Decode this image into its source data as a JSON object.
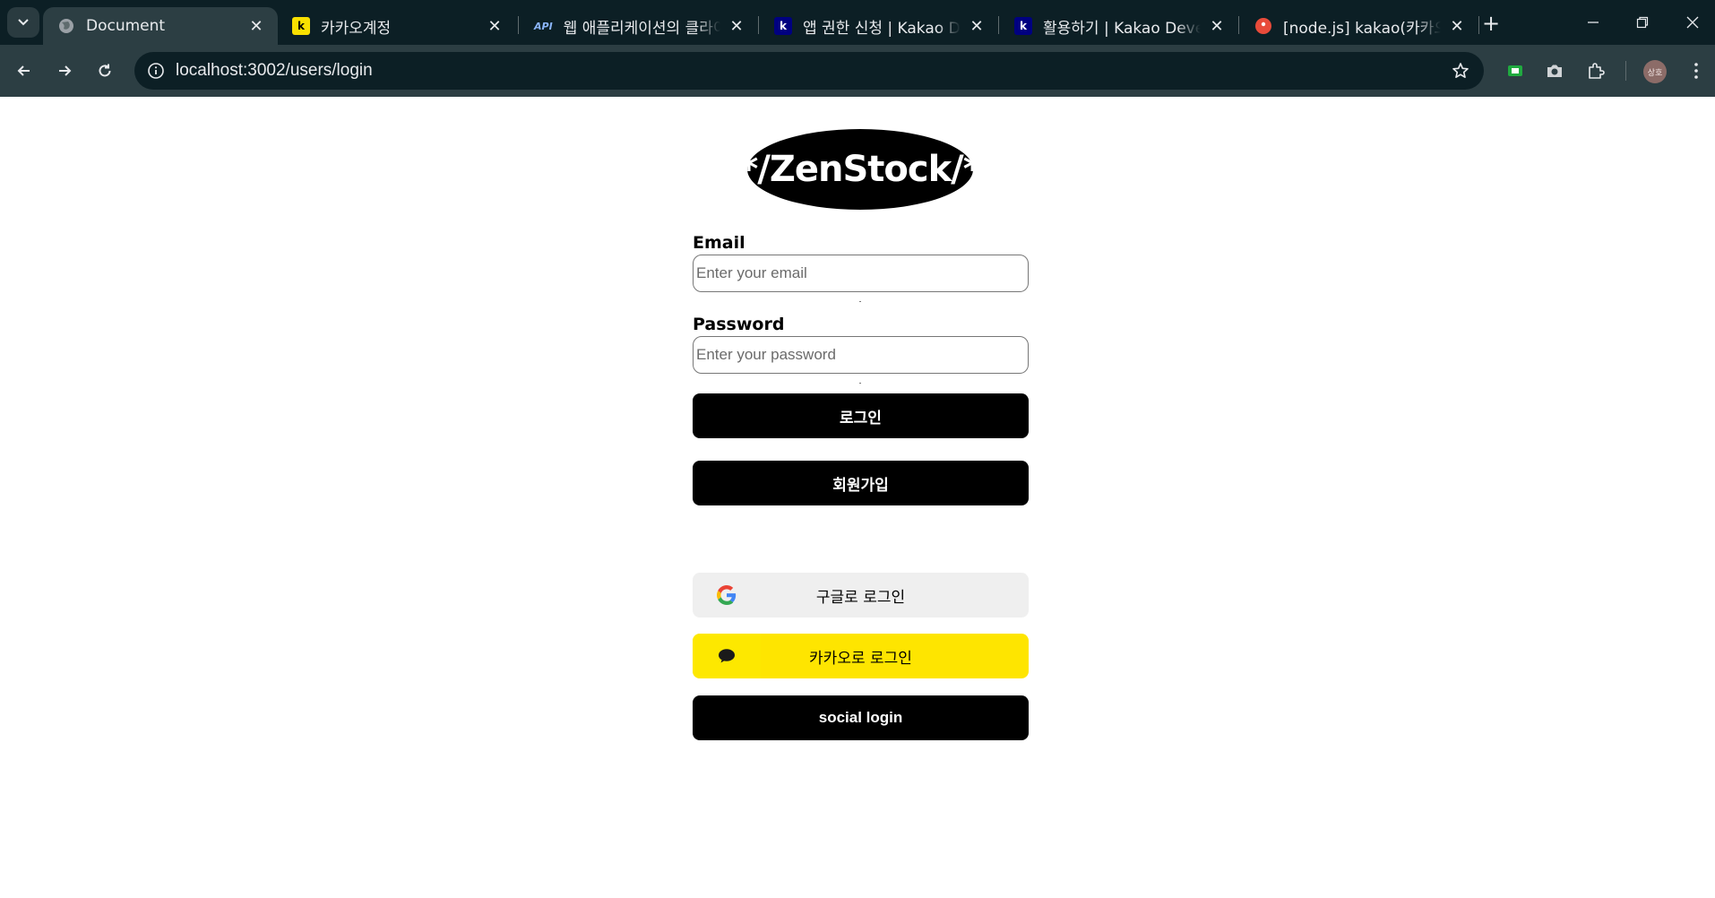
{
  "browser": {
    "tabs": [
      {
        "title": "Document",
        "favicon": "globe-icon",
        "active": true
      },
      {
        "title": "카카오계정",
        "favicon": "kakao-k-icon",
        "favicon_color": "#f9e000"
      },
      {
        "title": "웹 애플리케이션의 클라이언",
        "favicon": "api-icon"
      },
      {
        "title": "앱 권한 신청 | Kakao Deve",
        "favicon": "kakao-dev-icon",
        "favicon_color": "#000080"
      },
      {
        "title": "활용하기 | Kakao Develop",
        "favicon": "kakao-dev-icon",
        "favicon_color": "#000080"
      },
      {
        "title": "[node.js] kakao(카카오) O",
        "favicon": "blog-icon",
        "favicon_color": "#e84b3a"
      }
    ],
    "url": "localhost:3002/users/login",
    "profile_initials": "상호"
  },
  "page": {
    "logo_text": "*/ZenStock/*",
    "email": {
      "label": "Email",
      "placeholder": "Enter your email",
      "value": ""
    },
    "password": {
      "label": "Password",
      "placeholder": "Enter your password",
      "value": ""
    },
    "login_button": "로그인",
    "signup_button": "회원가입",
    "google_button": "구글로 로그인",
    "kakao_button": "카카오로 로그인",
    "social_button": "social login"
  },
  "colors": {
    "kakao_yellow": "#fee500",
    "google_gray": "#efefef",
    "primary_black": "#000000",
    "chrome_dark": "#0c1f25",
    "chrome_toolbar": "#2c3e43"
  }
}
